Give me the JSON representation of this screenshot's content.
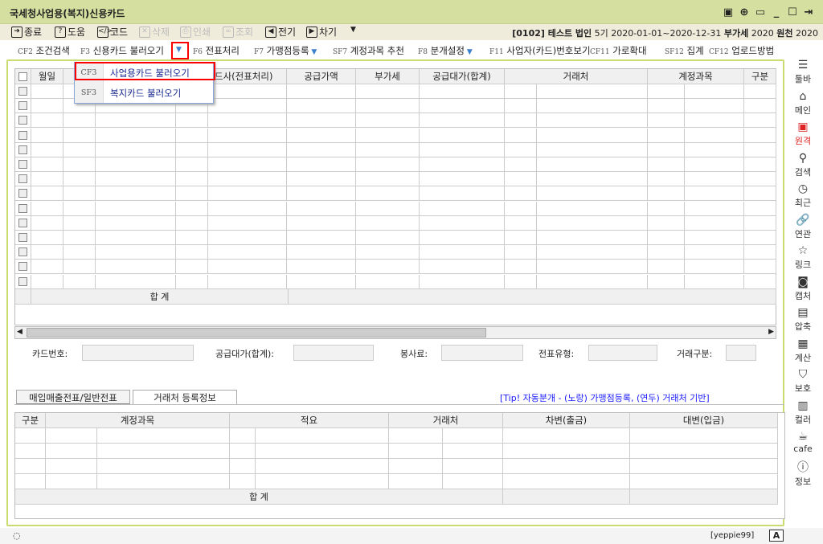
{
  "window": {
    "title": "국세청사업용(복지)신용카드"
  },
  "toolbar": [
    {
      "label": "종료",
      "icon": "exit-icon",
      "enabled": true
    },
    {
      "label": "도움",
      "icon": "help-icon",
      "enabled": true
    },
    {
      "label": "코드",
      "icon": "code-icon",
      "enabled": true
    },
    {
      "label": "삭제",
      "icon": "delete-icon",
      "enabled": false
    },
    {
      "label": "인쇄",
      "icon": "print-icon",
      "enabled": false
    },
    {
      "label": "조회",
      "icon": "search-icon",
      "enabled": false
    },
    {
      "label": "전기",
      "icon": "prev-icon",
      "enabled": true
    },
    {
      "label": "차기",
      "icon": "next-icon",
      "enabled": true
    }
  ],
  "info": {
    "company": "[0102] 테스트 법인",
    "period": "5기",
    "range": "2020-01-01~2020-12-31",
    "vat_label": "부가세",
    "vat_year": "2020",
    "wh_label": "원천",
    "wh_year": "2020"
  },
  "fkeys": [
    {
      "key": "CF2",
      "label": "조건검색"
    },
    {
      "key": "F3",
      "label": "신용카드 불러오기"
    },
    {
      "key": "F6",
      "label": "전표처리"
    },
    {
      "key": "F7",
      "label": "가맹점등록"
    },
    {
      "key": "SF7",
      "label": "계정과목 추천"
    },
    {
      "key": "F8",
      "label": "분개설정"
    },
    {
      "key": "F11",
      "label": "사업자(카드)번호보기"
    },
    {
      "key": "CF11",
      "label": "가로확대"
    },
    {
      "key": "SF12",
      "label": "집계"
    },
    {
      "key": "CF12",
      "label": "업로드방법"
    }
  ],
  "dropdown": [
    {
      "key": "CF3",
      "label": "사업용카드 불러오기"
    },
    {
      "key": "SF3",
      "label": "복지카드 불러오기"
    }
  ],
  "grid": {
    "headers": {
      "date": "월일",
      "card": "드사(전표처리)",
      "supply": "공급가액",
      "vat": "부가세",
      "total": "공급대가(합계)",
      "vendor": "거래처",
      "account": "계정과목",
      "type": "구분"
    },
    "sum_label": "합 계"
  },
  "fields": {
    "card_no": "카드번호:",
    "total": "공급대가(합계):",
    "service": "봉사료:",
    "slip_type": "전표유형:",
    "trade_type": "거래구분:"
  },
  "tabs": [
    "매입매출전표/일반전표",
    "거래처 등록정보"
  ],
  "tip": "[Tip! 자동분개 - (노랑) 가맹점등록, (연두) 거래처 기반]",
  "lower": {
    "headers": [
      "구분",
      "계정과목",
      "적요",
      "거래처",
      "차변(출금)",
      "대변(입금)"
    ],
    "sum_label": "합 계"
  },
  "sidebar": [
    {
      "label": "툴바",
      "icon": "menu-icon"
    },
    {
      "label": "메인",
      "icon": "home-icon"
    },
    {
      "label": "원격",
      "icon": "remote-icon"
    },
    {
      "label": "검색",
      "icon": "search-icon"
    },
    {
      "label": "최근",
      "icon": "clock-icon"
    },
    {
      "label": "연관",
      "icon": "link-icon"
    },
    {
      "label": "링크",
      "icon": "star-icon"
    },
    {
      "label": "캡처",
      "icon": "camera-icon"
    },
    {
      "label": "압축",
      "icon": "zip-icon"
    },
    {
      "label": "계산",
      "icon": "calculator-icon"
    },
    {
      "label": "보호",
      "icon": "shield-icon"
    },
    {
      "label": "컬러",
      "icon": "color-icon"
    },
    {
      "label": "cafe",
      "icon": "cafe-icon"
    },
    {
      "label": "정보",
      "icon": "info-icon"
    }
  ],
  "status": {
    "user": "[yeppie99]",
    "ime": "A"
  }
}
